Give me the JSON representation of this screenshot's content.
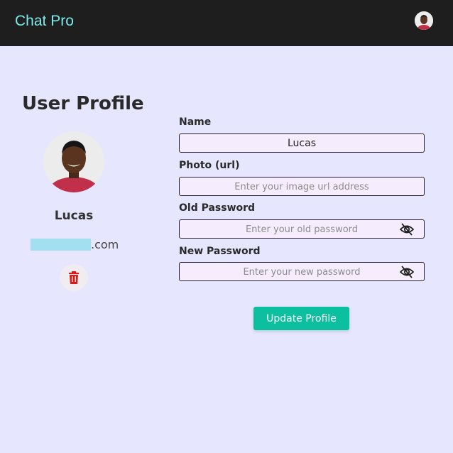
{
  "app": {
    "brand": "Chat Pro"
  },
  "page": {
    "title": "User Profile"
  },
  "profile": {
    "name": "Lucas",
    "email_domain": ".com"
  },
  "form": {
    "name": {
      "label": "Name",
      "value": "Lucas"
    },
    "photo": {
      "label": "Photo (url)",
      "placeholder": "Enter your image url address"
    },
    "old_password": {
      "label": "Old Password",
      "placeholder": "Enter your old password"
    },
    "new_password": {
      "label": "New Password",
      "placeholder": "Enter your new password"
    },
    "submit_label": "Update Profile"
  },
  "icons": {
    "delete": "trash-icon",
    "visibility": "eye-off-icon"
  },
  "colors": {
    "navbar": "#1e1e1e",
    "brand": "#7fe8e8",
    "background": "#e6e6fe",
    "input_bg": "#f5edfd",
    "primary_button": "#0cbf9e",
    "delete_icon": "#e01818"
  }
}
